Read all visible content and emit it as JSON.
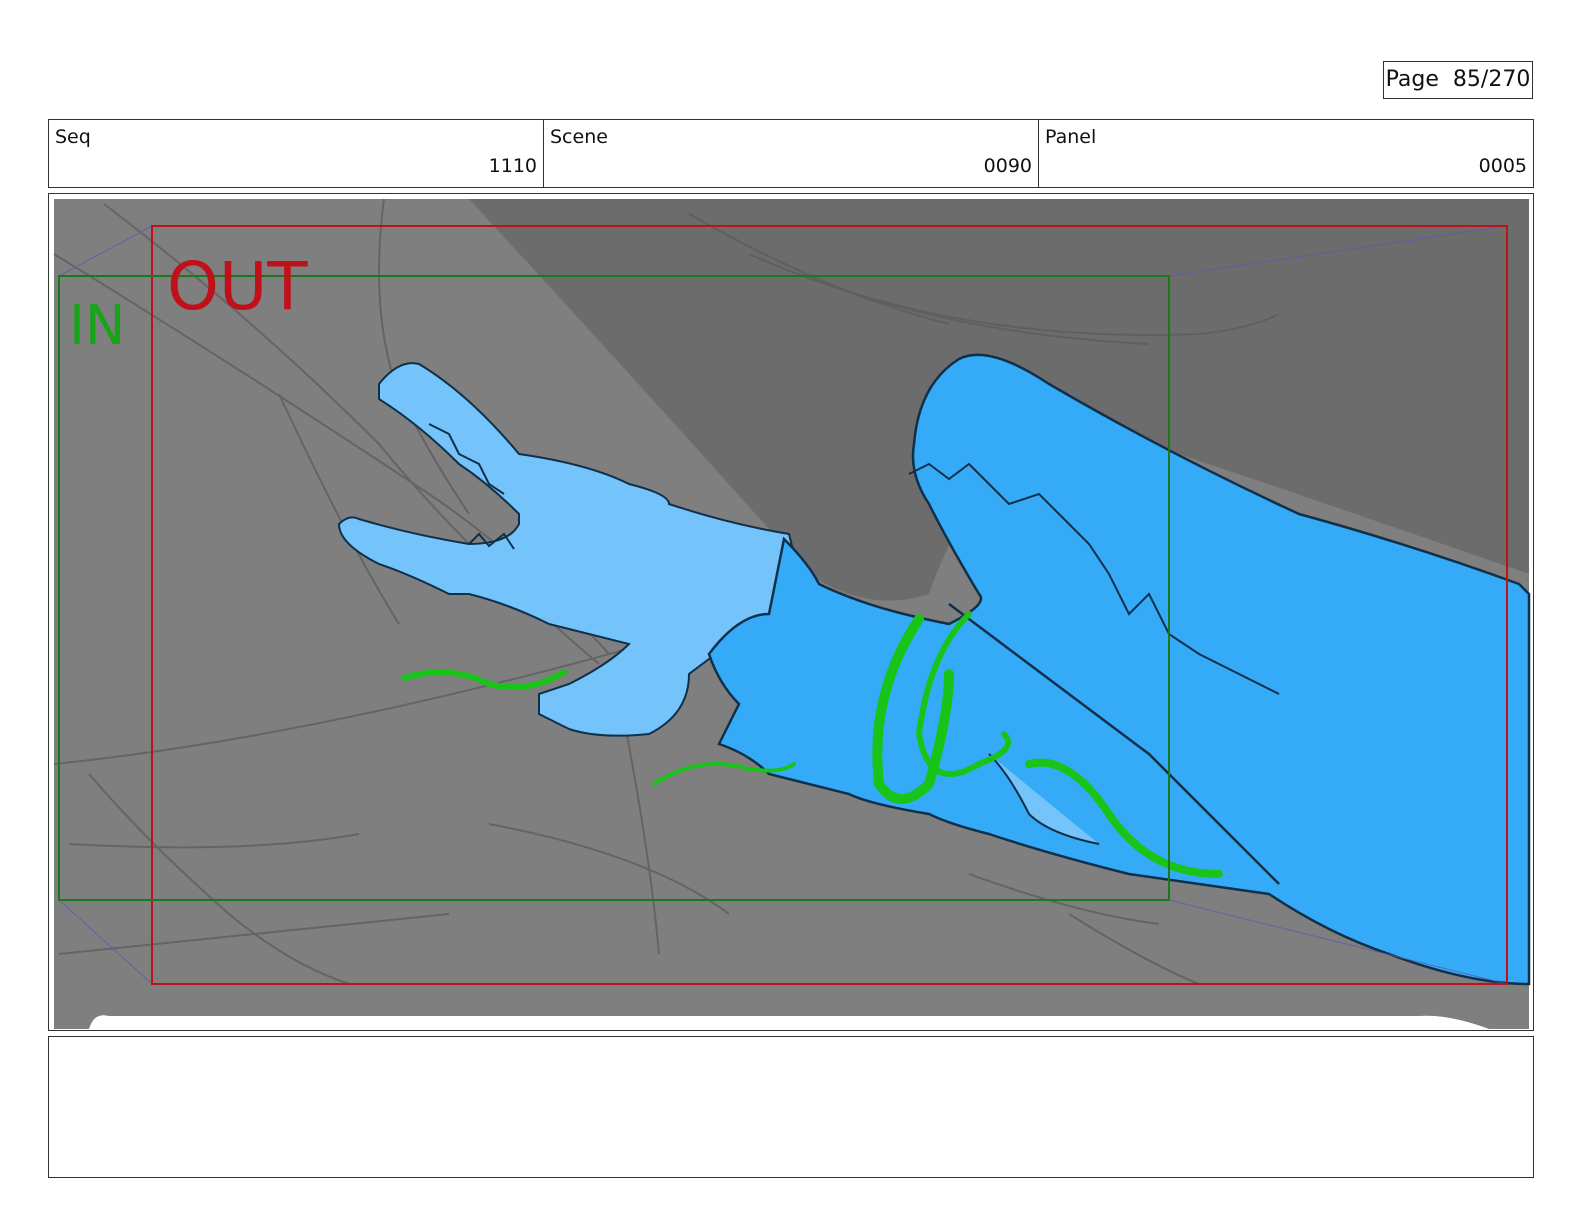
{
  "page": {
    "label": "Page",
    "number": "85/270"
  },
  "header": {
    "seq": {
      "label": "Seq",
      "value": "1110"
    },
    "scene": {
      "label": "Scene",
      "value": "0090"
    },
    "panel": {
      "label": "Panel",
      "value": "0005"
    }
  },
  "frame": {
    "in_label": "IN",
    "out_label": "OUT",
    "colors": {
      "in_frame": "#1a7a1a",
      "out_frame": "#c0101a",
      "background": "#7f7f7f",
      "creature_light": "#74c4fb",
      "creature_dark": "#35abf7",
      "motion_lines": "#18c418"
    }
  },
  "notes": {
    "text": ""
  }
}
